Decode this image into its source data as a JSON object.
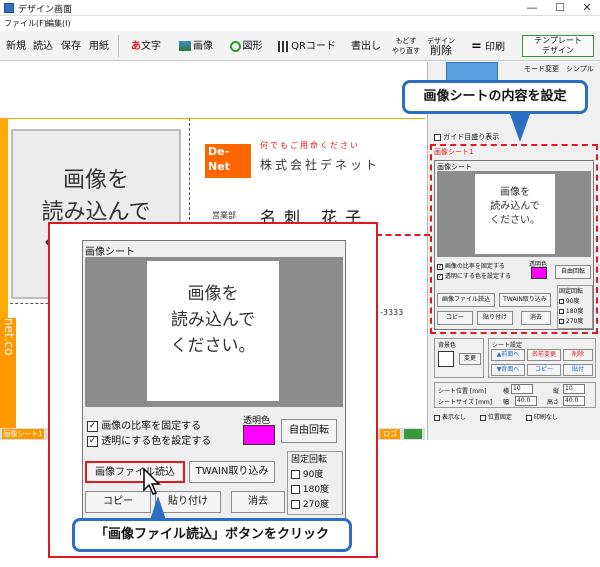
{
  "window": {
    "title": "デザイン画面",
    "minimize": "—",
    "maximize": "☐",
    "close": "✕"
  },
  "menu": [
    "ファイル(F)",
    "編集(I)"
  ],
  "toolbar": {
    "new": "新規",
    "load": "読込",
    "save": "保存",
    "paper": "用紙",
    "text": "文字",
    "text_glyph": "あ",
    "image": "画像",
    "shape": "図形",
    "qr": "QRコード",
    "write": "書出し",
    "undo_line1": "もどす",
    "undo_line2": "やり直す",
    "delete_line1": "デザイン",
    "delete_line2": "削除",
    "print": "印刷",
    "template_line1": "テンプレート",
    "template_line2": "デザイン"
  },
  "side_top": {
    "mode_label": "モード変更",
    "simple_label": "シンプル",
    "guide_label": "ガイド目盛り表示"
  },
  "card": {
    "tagline": "何でもご用命ください",
    "company": "株式会社デネット",
    "dept": "営業部",
    "name": "名刺 花子",
    "logo_top": "De-",
    "logo_bottom": "Net",
    "logo_small": "ON THE",
    "phone_suffix": "-3333",
    "vertical_url": "net.co"
  },
  "image_placeholder": "画像を\n読み込んで\nください。",
  "image_placeholder_small": "画像を\n読み込んで\nください。",
  "callout_top": "画像シートの内容を設定",
  "callout_bottom": "「画像ファイル読込」ボタンをクリック",
  "sheet_small": {
    "sheet_label": "画像シート1",
    "group_label": "画像シート",
    "fix_ratio": "画像の比率を固定する",
    "transparent": "透明にする色を設定する",
    "trans_color": "透明色",
    "free_rotate": "自由回転",
    "load_file": "画像ファイル読込",
    "twain": "TWAIN取り込み",
    "copy": "コピー",
    "paste": "貼り付け",
    "erase": "消去",
    "fixed_rotate": "固定回転",
    "deg90": "90度",
    "deg180": "180度",
    "deg270": "270度"
  },
  "sheet_zoom": {
    "group_label": "画像シート",
    "fix_ratio": "画像の比率を固定する",
    "transparent": "透明にする色を設定する",
    "trans_color": "透明色",
    "free_rotate": "自由回転",
    "load_file": "画像ファイル読込",
    "twain": "TWAIN取り込み",
    "copy": "コピー",
    "paste": "貼り付け",
    "erase": "消去",
    "fixed_rotate": "固定回転",
    "deg90": "90度",
    "deg180": "180度",
    "deg270": "270度"
  },
  "bg_panel": {
    "bg_label": "背景色",
    "change": "変更",
    "sheet_settings": "シート設定",
    "front": "▲前面へ",
    "rename": "名前変更",
    "delete": "削除",
    "back": "▼背面へ",
    "copy": "コピー",
    "paste": "貼付",
    "pos_label": "シート位置 [mm]",
    "horiz": "横",
    "vert": "縦",
    "pos_x": "10",
    "pos_y": "10",
    "size_label": "シートサイズ [mm]",
    "width": "幅",
    "height": "高さ",
    "w_val": "40.0",
    "h_val": "40.0",
    "hidden": "表示なし",
    "fix_pos": "位置固定",
    "no_print": "印刷なし"
  },
  "status": {
    "sheet_tab": "画像シート1",
    "right_tag": "ロゴ"
  },
  "colors": {
    "accent_red": "#e0191e",
    "callout_blue": "#2a6fc4",
    "magenta": "#ff00ff",
    "logo_orange": "#ff6600"
  }
}
